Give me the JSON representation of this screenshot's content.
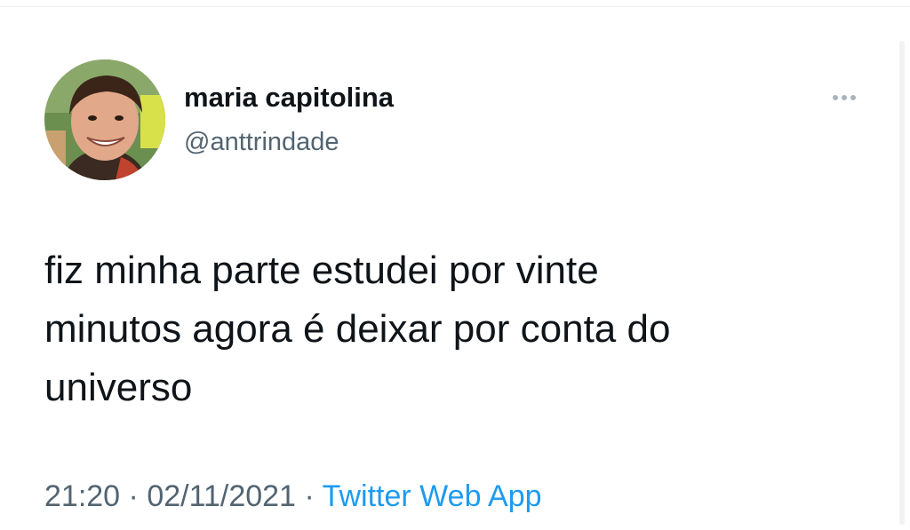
{
  "tweet": {
    "author": {
      "display_name": "maria capitolina",
      "handle": "@anttrindade"
    },
    "more_icon": "more-horizontal-icon",
    "text_lines": [
      "fiz minha parte estudei por vinte",
      "minutos agora é deixar por conta do",
      "universo"
    ],
    "time": "21:20",
    "separator": "·",
    "date": "02/11/2021",
    "source": "Twitter Web App"
  },
  "colors": {
    "text_primary": "#0f1419",
    "text_secondary": "#536471",
    "link": "#1d9bf0"
  }
}
